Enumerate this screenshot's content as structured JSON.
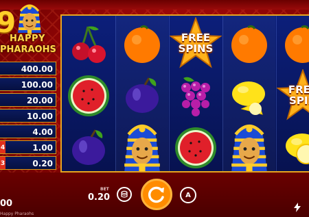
{
  "logo": {
    "number": "9",
    "line1": "HAPPY",
    "line2": "PHARAOHS"
  },
  "paytable": [
    {
      "level": "",
      "value": "400.00"
    },
    {
      "level": "",
      "value": "100.00"
    },
    {
      "level": "",
      "value": "20.00"
    },
    {
      "level": "",
      "value": "10.00"
    },
    {
      "level": "",
      "value": "4.00"
    },
    {
      "level": "4",
      "value": "1.00"
    },
    {
      "level": "3",
      "value": "0.20"
    }
  ],
  "reels": [
    [
      "cherry",
      "watermelon",
      "plum"
    ],
    [
      "orange",
      "plum",
      "pharaoh"
    ],
    [
      "free-spins",
      "grapes",
      "watermelon"
    ],
    [
      "orange",
      "lemon",
      "pharaoh"
    ],
    [
      "orange",
      "free-spins",
      "lemon"
    ]
  ],
  "free_spins": {
    "line1": "FREE",
    "line2": "SPINS",
    "line1_cut": "FREE",
    "line2_cut": "SPIN"
  },
  "bet": {
    "label": "BET",
    "value": "0.20"
  },
  "balance": "00",
  "game_name": "Happy Pharaohs",
  "auto_label": "A",
  "colors": {
    "accent": "#ff8c00",
    "frame": "#e6a51f",
    "reel_bg": "#0c1f7a",
    "background": "#8c0404"
  }
}
